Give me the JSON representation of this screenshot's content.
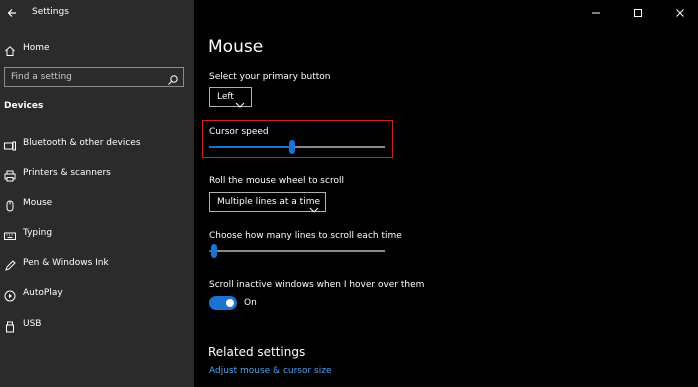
{
  "window": {
    "app_title": "Settings"
  },
  "sidebar": {
    "home_label": "Home",
    "search_placeholder": "Find a setting",
    "section_title": "Devices",
    "items": [
      {
        "label": "Bluetooth & other devices",
        "icon": "bluetooth-devices-icon"
      },
      {
        "label": "Printers & scanners",
        "icon": "printer-icon"
      },
      {
        "label": "Mouse",
        "icon": "mouse-icon"
      },
      {
        "label": "Typing",
        "icon": "keyboard-icon"
      },
      {
        "label": "Pen & Windows Ink",
        "icon": "pen-icon"
      },
      {
        "label": "AutoPlay",
        "icon": "autoplay-icon"
      },
      {
        "label": "USB",
        "icon": "usb-icon"
      }
    ]
  },
  "main": {
    "title": "Mouse",
    "primary_button": {
      "label": "Select your primary button",
      "value": "Left"
    },
    "cursor_speed": {
      "label": "Cursor speed",
      "value_fraction": 0.47
    },
    "scroll_wheel": {
      "label": "Roll the mouse wheel to scroll",
      "value": "Multiple lines at a time"
    },
    "scroll_lines": {
      "label": "Choose how many lines to scroll each time",
      "value_fraction": 0.03
    },
    "inactive_scroll": {
      "label": "Scroll inactive windows when I hover over them",
      "state": "On",
      "on": true
    },
    "related": {
      "title": "Related settings",
      "links": [
        "Adjust mouse & cursor size"
      ]
    }
  },
  "colors": {
    "accent": "#1a73d1",
    "highlight": "#d21f1f",
    "sidebar_bg": "#2b2b2b",
    "main_bg": "#000000",
    "link": "#4ea2f2"
  }
}
